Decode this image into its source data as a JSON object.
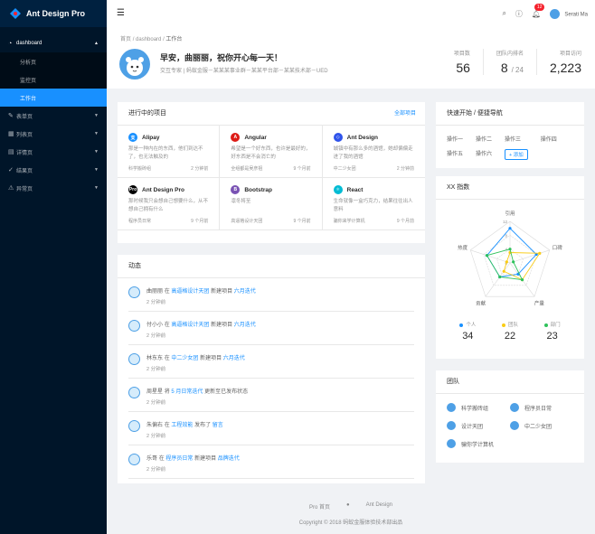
{
  "app": {
    "name": "Ant Design Pro"
  },
  "sidebar": {
    "items": [
      {
        "label": "dashboard",
        "icon": "dashboard-icon",
        "open": true
      },
      {
        "label": "分析页"
      },
      {
        "label": "监控页"
      },
      {
        "label": "工作台",
        "active": true
      },
      {
        "label": "表单页",
        "icon": "form-icon"
      },
      {
        "label": "列表页",
        "icon": "table-icon"
      },
      {
        "label": "详情页",
        "icon": "profile-icon"
      },
      {
        "label": "结果页",
        "icon": "check-circle-icon"
      },
      {
        "label": "异常页",
        "icon": "warning-icon"
      }
    ]
  },
  "header": {
    "notification_count": "12",
    "user_name": "Serati Ma"
  },
  "page": {
    "breadcrumb": [
      "首页",
      "dashboard",
      "工作台"
    ],
    "greeting": "早安，曲丽丽，祝你开心每一天！",
    "description": "交互专家 | 蚂蚁金服－某某某事业群－某某平台部－某某技术部－UED",
    "stats": [
      {
        "label": "项目数",
        "value": "56"
      },
      {
        "label": "团队内排名",
        "value": "8",
        "suffix": "/ 24"
      },
      {
        "label": "项目访问",
        "value": "2,223"
      }
    ]
  },
  "projects": {
    "title": "进行中的项目",
    "extra": "全部项目",
    "items": [
      {
        "name": "Alipay",
        "color": "#1890ff",
        "glyph": "支",
        "desc": "那是一种内在的东西，他们到达不了，也无法触及的",
        "team": "科学搬砖组",
        "time": "2 分钟前"
      },
      {
        "name": "Angular",
        "color": "#dd1b16",
        "glyph": "A",
        "desc": "希望是一个好东西，也许是最好的，好东西是不会消亡的",
        "team": "全组都是吴彦祖",
        "time": "9 个月前"
      },
      {
        "name": "Ant Design",
        "color": "#2f54eb",
        "glyph": "◇",
        "desc": "城镇中有那么多的酒馆，她却偏偏走进了我的酒馆",
        "team": "中二少女团",
        "time": "2 分钟前"
      },
      {
        "name": "Ant Design Pro",
        "color": "#000000",
        "glyph": "Pro",
        "desc": "那时候我只会想自己想要什么，从不想自己拥有什么",
        "team": "程序员日常",
        "time": "9 个月前"
      },
      {
        "name": "Bootstrap",
        "color": "#7952b3",
        "glyph": "B",
        "desc": "凛冬将至",
        "team": "高逼格设计天团",
        "time": "9 个月前"
      },
      {
        "name": "React",
        "color": "#00bcd4",
        "glyph": "⚛",
        "desc": "生命就像一盒巧克力，结果往往出人意料",
        "team": "骗你来学计算机",
        "time": "9 个月前"
      }
    ]
  },
  "activity": {
    "title": "动态",
    "items": [
      {
        "user": "曲丽丽",
        "verb": "在",
        "group": "高逼格设计天团",
        "action": "新建项目",
        "target": "六月迭代",
        "time": "2 分钟前"
      },
      {
        "user": "付小小",
        "verb": "在",
        "group": "高逼格设计天团",
        "action": "新建项目",
        "target": "六月迭代",
        "time": "2 分钟前"
      },
      {
        "user": "林东东",
        "verb": "在",
        "group": "中二少女团",
        "action": "新建项目",
        "target": "六月迭代",
        "time": "2 分钟前"
      },
      {
        "user": "周星星",
        "verb": "将",
        "group": "5 月日常迭代",
        "action": "更新至已发布状态",
        "target": "",
        "time": "2 分钟前"
      },
      {
        "user": "朱偏右",
        "verb": "在",
        "group": "工程效能",
        "action": "发布了",
        "target": "留言",
        "time": "2 分钟前"
      },
      {
        "user": "乐哥",
        "verb": "在",
        "group": "程序员日常",
        "action": "新建项目",
        "target": "品牌迭代",
        "time": "2 分钟前"
      }
    ]
  },
  "quick": {
    "title": "快速开始 / 便捷导航",
    "links": [
      "操作一",
      "操作二",
      "操作三",
      "操作四",
      "操作五",
      "操作六"
    ],
    "add_label": "+ 添加"
  },
  "radar": {
    "title": "XX 指数",
    "chart_data": {
      "type": "radar",
      "axes": [
        "引用",
        "口碑",
        "产量",
        "贡献",
        "热度"
      ],
      "rmax": 12,
      "ticks": [
        "12",
        "8",
        "4",
        "0"
      ],
      "series": [
        {
          "name": "个人",
          "color": "#1890ff",
          "values": [
            10,
            8,
            4,
            5,
            7
          ]
        },
        {
          "name": "团队",
          "color": "#facc14",
          "values": [
            3,
            9,
            6,
            3,
            1
          ]
        },
        {
          "name": "部门",
          "color": "#2fc25b",
          "values": [
            4,
            1,
            6,
            5,
            7
          ]
        }
      ]
    },
    "totals": [
      {
        "label": "个人",
        "value": "34",
        "color": "#1890ff"
      },
      {
        "label": "团队",
        "value": "22",
        "color": "#facc14"
      },
      {
        "label": "部门",
        "value": "23",
        "color": "#2fc25b"
      }
    ]
  },
  "team": {
    "title": "团队",
    "members": [
      "科学搬砖组",
      "程序员日常",
      "设计天团",
      "中二少女团",
      "骗你学计算机"
    ]
  },
  "footer": {
    "links": [
      "Pro 首页",
      "Ant Design"
    ],
    "copyright": "Copyright © 2018 蚂蚁金服体验技术部出品"
  }
}
